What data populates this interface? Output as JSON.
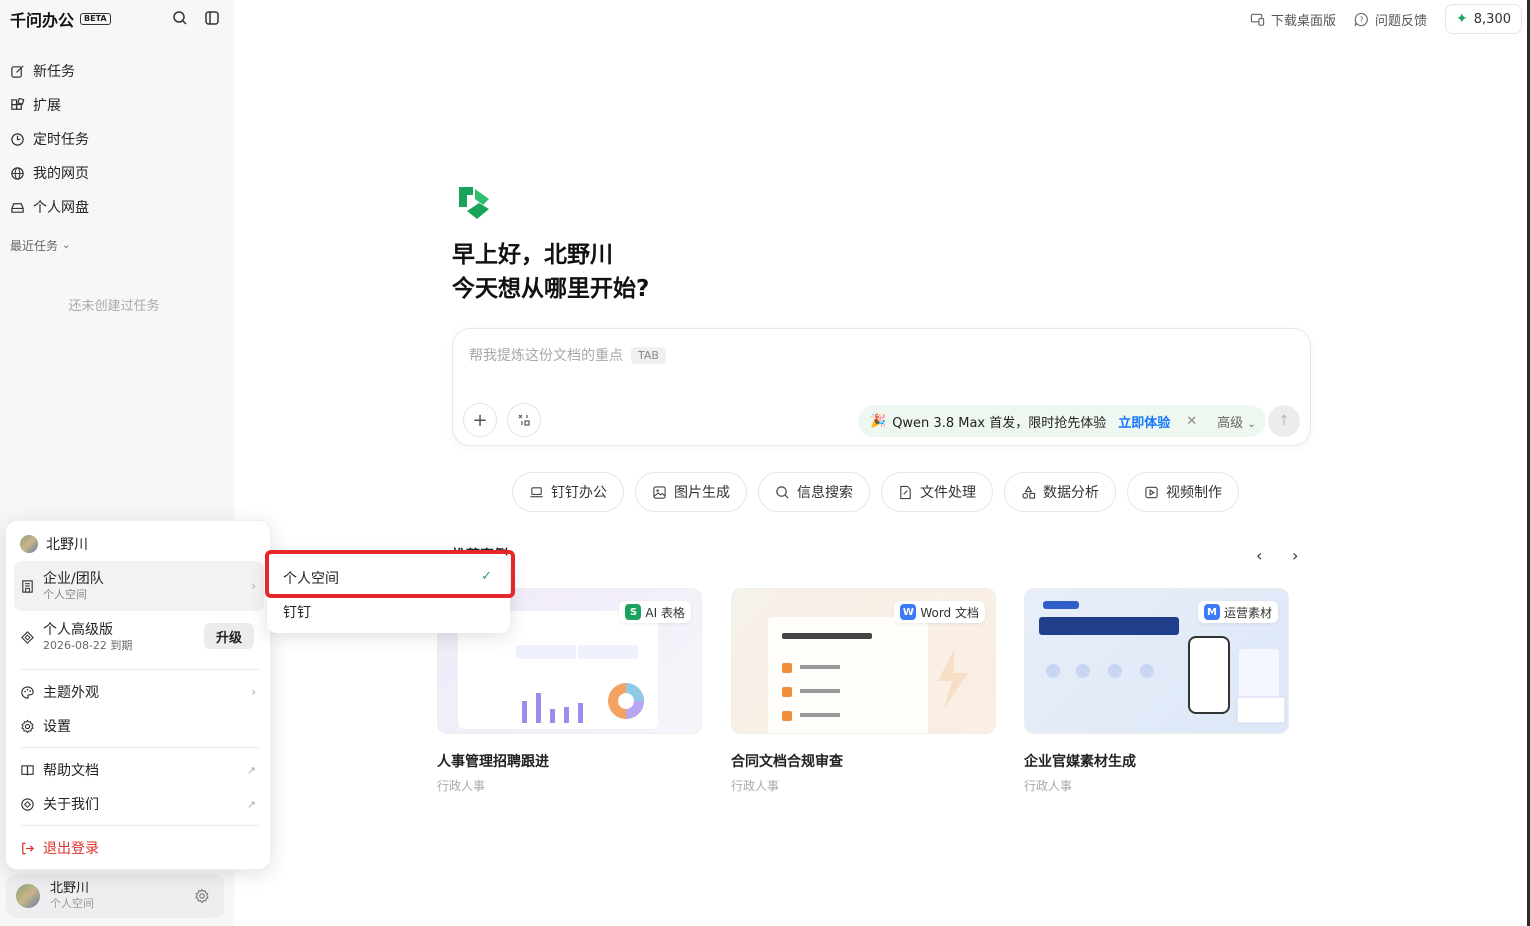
{
  "app": {
    "name": "千问办公",
    "badge": "BETA"
  },
  "sidebar": {
    "items": [
      {
        "label": "新任务",
        "icon": "edit-icon"
      },
      {
        "label": "扩展",
        "icon": "extensions-icon"
      },
      {
        "label": "定时任务",
        "icon": "clock-icon"
      },
      {
        "label": "我的网页",
        "icon": "globe-icon"
      },
      {
        "label": "个人网盘",
        "icon": "drive-icon"
      }
    ],
    "recent_label": "最近任务",
    "empty_text": "还未创建过任务"
  },
  "user": {
    "name": "北野川",
    "space": "个人空间"
  },
  "menu": {
    "user_name": "北野川",
    "team_label": "企业/团队",
    "team_sub": "个人空间",
    "plan_label": "个人高级版",
    "plan_expiry": "2026-08-22 到期",
    "upgrade_label": "升级",
    "theme_label": "主题外观",
    "settings_label": "设置",
    "help_label": "帮助文档",
    "about_label": "关于我们",
    "logout_label": "退出登录"
  },
  "submenu": {
    "items": [
      "个人空间",
      "钉钉"
    ],
    "selected": 0
  },
  "topbar": {
    "download_label": "下载桌面版",
    "feedback_label": "问题反馈",
    "credits": "8,300"
  },
  "hero": {
    "line1": "早上好，北野川",
    "line2": "今天想从哪里开始?"
  },
  "input": {
    "placeholder": "帮我提炼这份文档的重点",
    "tab_hint": "TAB",
    "promo_text": "Qwen 3.8 Max 首发，限时抢先体验",
    "promo_link": "立即体验",
    "level": "高级"
  },
  "chips": [
    {
      "label": "钉钉办公",
      "icon": "laptop-icon"
    },
    {
      "label": "图片生成",
      "icon": "image-icon"
    },
    {
      "label": "信息搜索",
      "icon": "search-icon"
    },
    {
      "label": "文件处理",
      "icon": "file-icon"
    },
    {
      "label": "数据分析",
      "icon": "shapes-icon"
    },
    {
      "label": "视频制作",
      "icon": "video-icon"
    }
  ],
  "recommend": {
    "title": "推荐案例",
    "cards": [
      {
        "title": "人事管理招聘跟进",
        "tag": "行政人事",
        "badge": "AI 表格",
        "badge_color": "#1aa35a"
      },
      {
        "title": "合同文档合规审查",
        "tag": "行政人事",
        "badge": "Word 文档",
        "badge_color": "#3b7bf6"
      },
      {
        "title": "企业官媒素材生成",
        "tag": "行政人事",
        "badge": "运营素材",
        "badge_color": "#3b7bf6"
      }
    ]
  },
  "colors": {
    "accent": "#1677ff",
    "brand_green": "#1aa35a",
    "danger": "#d9342b",
    "highlight": "#e5262b"
  }
}
